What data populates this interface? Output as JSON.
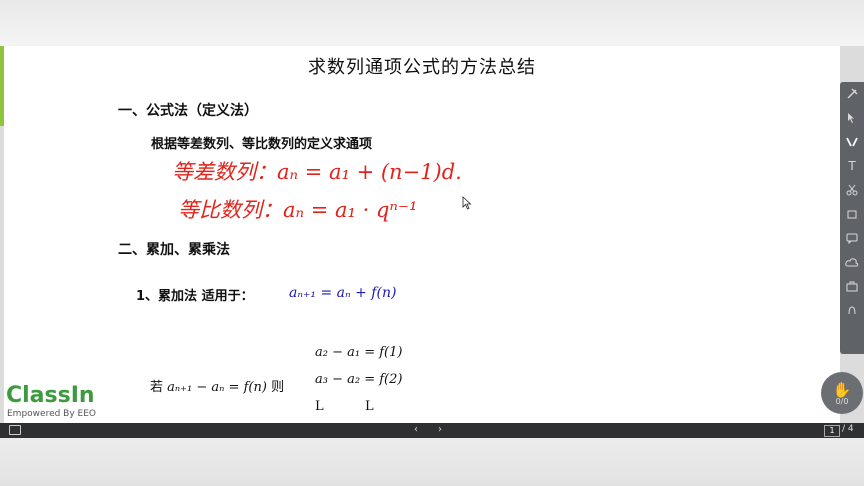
{
  "slide": {
    "title": "求数列通项公式的方法总结",
    "section1_heading": "一、公式法（定义法）",
    "section1_text": "根据等差数列、等比数列的定义求通项",
    "handwriting_line1": "等差数列：aₙ = a₁ + (n−1)d.",
    "handwriting_line2": "等比数列：aₙ = a₁ · qⁿ⁻¹",
    "section2_heading": "二、累加、累乘法",
    "sub1_label": "1、累加法   适用于：",
    "sub1_formula": "aₙ₊₁ = aₙ + f(n)",
    "condition_prefix": "若",
    "condition_formula": "aₙ₊₁ − aₙ = f(n)",
    "condition_suffix": "则",
    "eq_lines": [
      "a₂ − a₁ = f(1)",
      "a₃ − a₂ = f(2)",
      "L          L"
    ]
  },
  "toolbar": {
    "tools": [
      "clear-icon",
      "mouse-icon",
      "pen-icon",
      "text-icon",
      "scissors-icon",
      "eraser-icon",
      "chat-icon",
      "cloud-icon",
      "toolbox-icon",
      "more-icon"
    ],
    "active_tool": "pen-icon",
    "text_tool_label": "T",
    "hand_count": "0/0"
  },
  "logo": {
    "name_part1": "Class",
    "name_part2": "In",
    "tagline": "Empowered By EEO"
  },
  "bottom_bar": {
    "prev_label": "‹",
    "next_label": "›",
    "current_page": "1",
    "total_pages": "/ 4"
  },
  "colors": {
    "handwriting": "#e0231c",
    "formula_blue": "#1a1ab5",
    "logo_green": "#3f9a3f",
    "toolbar_bg": "#5f6368"
  }
}
